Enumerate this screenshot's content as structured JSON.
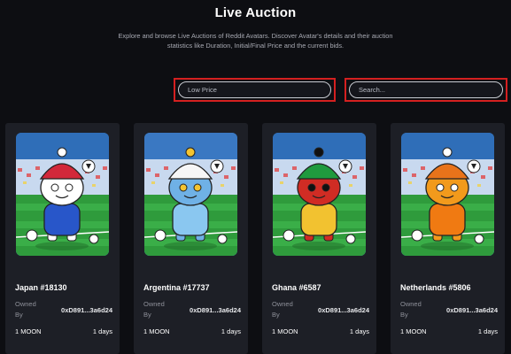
{
  "header": {
    "title": "Live Auction",
    "description": "Explore and browse Live Auctions of Reddit Avatars. Discover Avatar's details and their auction statistics like Duration, Initial/Final Price and the current bids."
  },
  "filters": {
    "price_placeholder": "Low Price",
    "search_placeholder": "Search..."
  },
  "cards": [
    {
      "name": "Japan #18130",
      "owned_label": "Owned By",
      "owner": "0xD891...3a6d24",
      "price": "1 MOON",
      "duration": "1 days",
      "theme": {
        "body": "#ffffff",
        "shirt": "#2856c9",
        "hat": "#d2283a",
        "accent": "#ffffff",
        "sky": "#2f6eb8"
      }
    },
    {
      "name": "Argentina #17737",
      "owned_label": "Owned By",
      "owner": "0xD891...3a6d24",
      "price": "1 MOON",
      "duration": "1 days",
      "theme": {
        "body": "#6fb1e6",
        "shirt": "#8ac7f0",
        "hat": "#f6f6f6",
        "accent": "#f4c430",
        "sky": "#3a78c2"
      }
    },
    {
      "name": "Ghana #6587",
      "owned_label": "Owned By",
      "owner": "0xD891...3a6d24",
      "price": "1 MOON",
      "duration": "1 days",
      "theme": {
        "body": "#d02c24",
        "shirt": "#f2c230",
        "hat": "#1f9a3e",
        "accent": "#111111",
        "sky": "#2f6eb8"
      }
    },
    {
      "name": "Netherlands #5806",
      "owned_label": "Owned By",
      "owner": "0xD891...3a6d24",
      "price": "1 MOON",
      "duration": "1 days",
      "theme": {
        "body": "#f29a1c",
        "shirt": "#f07a12",
        "hat": "#e8731a",
        "accent": "#ffffff",
        "sky": "#2f6eb8"
      }
    }
  ]
}
